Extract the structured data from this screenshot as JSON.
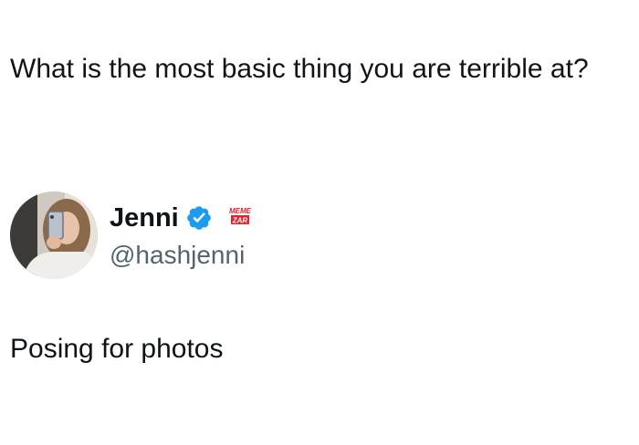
{
  "question": {
    "text": "What is the most basic thing you are terrible at?"
  },
  "author": {
    "display_name": "Jenni",
    "handle": "@hashjenni",
    "verified": true,
    "verified_color": "#1d9bf0",
    "avatar_icon": "profile-photo"
  },
  "watermark": {
    "line1": "MEME",
    "line2": "ZAR",
    "color": "#e0242b"
  },
  "reply": {
    "text": "Posing for photos"
  }
}
